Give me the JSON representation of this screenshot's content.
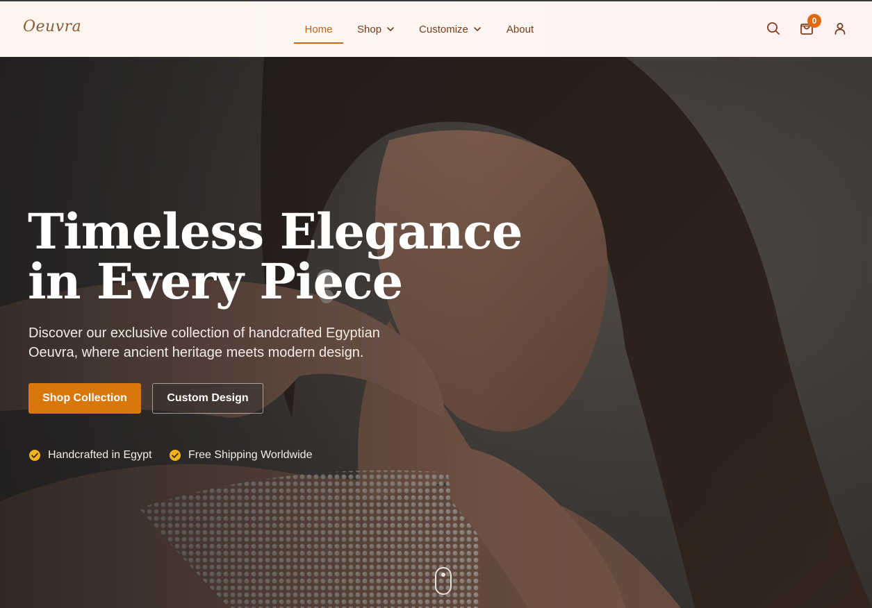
{
  "brand": {
    "logo_text": "Oeuvra"
  },
  "nav": {
    "home": "Home",
    "shop": "Shop",
    "customize": "Customize",
    "about": "About"
  },
  "header_icons": {
    "search": "search-icon",
    "cart": "cart-icon",
    "user": "user-icon",
    "cart_count": "0"
  },
  "hero": {
    "title_line1": "Timeless Elegance",
    "title_line2": "in Every Piece",
    "subtitle_line1": "Discover our exclusive collection of handcrafted Egyptian",
    "subtitle_line2": "Oeuvra, where ancient heritage meets modern design.",
    "primary_button": "Shop Collection",
    "secondary_button": "Custom Design",
    "features": [
      "Handcrafted in Egypt",
      "Free Shipping Worldwide"
    ]
  },
  "colors": {
    "accent": "#d9780a",
    "nav_active": "#c4601c",
    "nav_text": "#7a3b1a",
    "badge": "#df6a14",
    "check": "#f2b21b"
  }
}
